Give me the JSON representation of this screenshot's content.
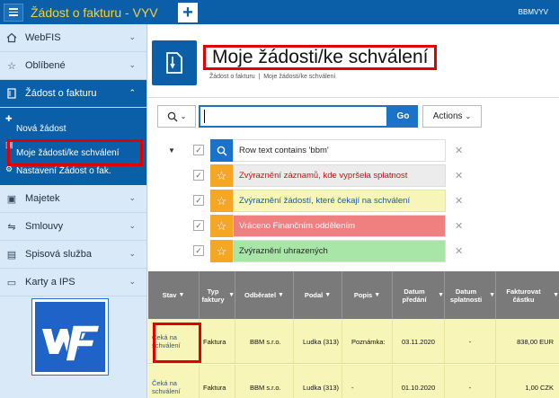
{
  "header": {
    "app_title": "Žádost o fakturu - VYV",
    "add_label": "+",
    "user": "BBMVYV"
  },
  "sidebar": {
    "items": [
      {
        "label": "WebFIS",
        "icon": "house-icon"
      },
      {
        "label": "Oblíbené",
        "icon": "star-icon"
      },
      {
        "label": "Žádost o fakturu",
        "icon": "document-icon"
      },
      {
        "label": "Majetek",
        "icon": "cube-icon"
      },
      {
        "label": "Smlouvy",
        "icon": "handshake-icon"
      },
      {
        "label": "Spisová služba",
        "icon": "file-icon"
      },
      {
        "label": "Karty a IPS",
        "icon": "card-icon"
      }
    ],
    "subitems": [
      {
        "label": "Nová žádost"
      },
      {
        "label": "Moje žádosti/ke schválení"
      },
      {
        "label": "Nastavení Žádost o fak."
      }
    ]
  },
  "page": {
    "title": "Moje žádosti/ke schválení",
    "breadcrumb": [
      "Žádost o fakturu",
      "Moje žádosti/ke schválení"
    ]
  },
  "search": {
    "value": "",
    "go_label": "Go",
    "actions_label": "Actions"
  },
  "filters": [
    {
      "text": "Row text contains 'bbm'",
      "icon": "search-icon",
      "bg": "#ffffff",
      "color": "#262626",
      "icon_bg": "#1a73c8"
    },
    {
      "text": "Zvýraznění záznamů, kde vypršela splatnost",
      "icon": "star-icon",
      "bg": "#ececec",
      "color": "#d01010",
      "icon_bg": "#f5a623"
    },
    {
      "text": "Zvýraznění žádostí, které čekají na schválení",
      "icon": "star-icon",
      "bg": "#f7f5b8",
      "color": "#1a58b8",
      "icon_bg": "#f5a623"
    },
    {
      "text": "Vráceno Finančním oddělením",
      "icon": "star-icon",
      "bg": "#f08080",
      "color": "#ffffff",
      "icon_bg": "#f5a623"
    },
    {
      "text": "Zvýraznění uhrazených",
      "icon": "star-icon",
      "bg": "#a8e6a8",
      "color": "#262626",
      "icon_bg": "#f5a623"
    }
  ],
  "table": {
    "columns": [
      "Stav",
      "Typ faktury",
      "Odběratel",
      "Podal",
      "Popis",
      "Datum předání",
      "Datum splatnosti",
      "Fakturovat částku"
    ],
    "rows": [
      [
        "Čeká na schválení",
        "Faktura",
        "BBM s.r.o.",
        "Ludka (313)",
        "Poznámka:",
        "03.11.2020",
        "-",
        "838,00 EUR"
      ],
      [
        "Čeká na schválení",
        "Faktura",
        "BBM s.r.o.",
        "Ludka (313)",
        "-",
        "01.10.2020",
        "-",
        "1,00 CZK"
      ]
    ]
  },
  "colors": {
    "header": "#0b5fa8",
    "title_accent": "#f7d035",
    "row_highlight": "#f7f5b8",
    "annotation": "#e00000"
  }
}
